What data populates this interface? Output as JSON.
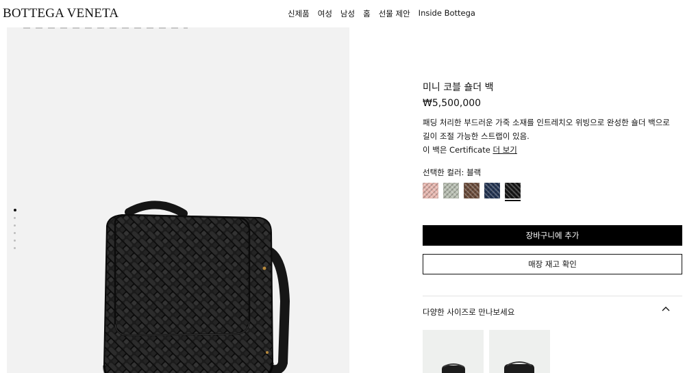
{
  "header": {
    "logo": "BOTTEGA VENETA",
    "nav": [
      "신제품",
      "여성",
      "남성",
      "홈",
      "선물 제안",
      "Inside Bottega"
    ]
  },
  "gallery": {
    "slide_count": 6,
    "active_slide": 1
  },
  "product": {
    "title": "미니 코블 숄더 백",
    "price": "₩5,500,000",
    "description_line1": "패딩 처리한 부드러운 가죽 소재를 인트레치오 위빙으로 완성한 숄더 백으로",
    "description_line2": "길이 조절 가능한 스트랩이 있음.",
    "cert_prefix": "이 백은 Certificate ",
    "cert_link": "더 보기",
    "color_label": "선택한 컬러: 블랙",
    "swatches": [
      {
        "name": "pink",
        "color": "#e7b6ae"
      },
      {
        "name": "sage",
        "color": "#b7beb1"
      },
      {
        "name": "brown",
        "color": "#6b4c3b"
      },
      {
        "name": "navy",
        "color": "#233453"
      },
      {
        "name": "black",
        "color": "#161616"
      }
    ],
    "selected_swatch": "black",
    "add_to_cart": "장바구니에 추가",
    "store_stock": "매장 재고 확인",
    "sizes_label": "다양한 사이즈로 만나보세요"
  }
}
